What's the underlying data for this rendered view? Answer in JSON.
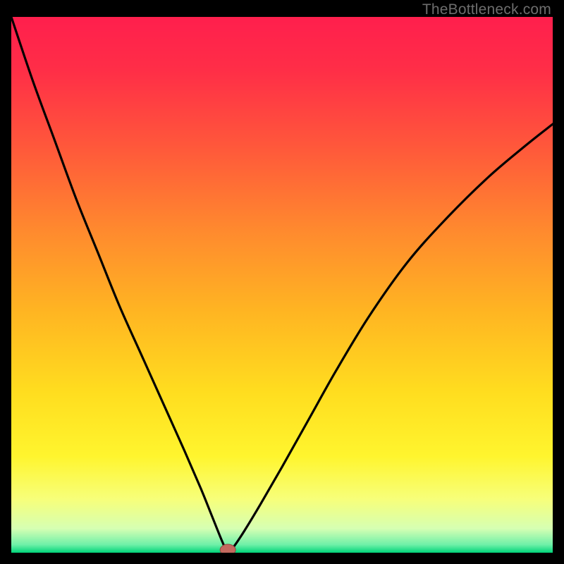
{
  "watermark": "TheBottleneck.com",
  "colors": {
    "frame": "#000000",
    "gradient_stops": [
      {
        "offset": 0.0,
        "color": "#ff1f4d"
      },
      {
        "offset": 0.1,
        "color": "#ff2e47"
      },
      {
        "offset": 0.25,
        "color": "#ff5a3a"
      },
      {
        "offset": 0.4,
        "color": "#ff8a2e"
      },
      {
        "offset": 0.55,
        "color": "#ffb522"
      },
      {
        "offset": 0.7,
        "color": "#ffdd1f"
      },
      {
        "offset": 0.82,
        "color": "#fff52e"
      },
      {
        "offset": 0.9,
        "color": "#f7ff7a"
      },
      {
        "offset": 0.955,
        "color": "#d6ffb3"
      },
      {
        "offset": 0.985,
        "color": "#6ff0a8"
      },
      {
        "offset": 1.0,
        "color": "#00d47a"
      }
    ],
    "curve": "#000000",
    "marker_fill": "#c46a5f",
    "marker_stroke": "#8f4a43"
  },
  "chart_data": {
    "type": "line",
    "title": "",
    "xlabel": "",
    "ylabel": "",
    "xlim": [
      0,
      100
    ],
    "ylim": [
      0,
      100
    ],
    "minimum_point": {
      "x": 40,
      "y": 0
    },
    "series": [
      {
        "name": "bottleneck-curve",
        "x": [
          0,
          4,
          8,
          12,
          16,
          20,
          24,
          28,
          32,
          35,
          37,
          39,
          40,
          41,
          43,
          46,
          50,
          55,
          60,
          66,
          73,
          80,
          88,
          95,
          100
        ],
        "y": [
          100,
          88,
          77,
          66,
          56,
          46,
          37,
          28,
          19,
          12,
          7,
          2,
          0,
          1,
          4,
          9,
          16,
          25,
          34,
          44,
          54,
          62,
          70,
          76,
          80
        ]
      }
    ],
    "marker": {
      "x": 40,
      "y": 0
    }
  }
}
